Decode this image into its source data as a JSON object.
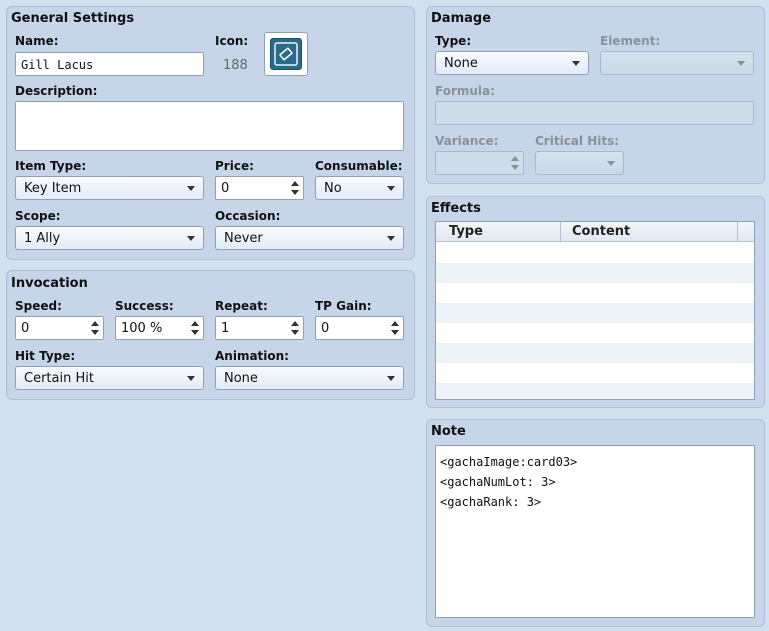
{
  "general": {
    "title": "General Settings",
    "name_label": "Name:",
    "name_value": "Gill Lacus",
    "icon_label": "Icon:",
    "icon_index": "188",
    "description_label": "Description:",
    "description_value": "",
    "item_type_label": "Item Type:",
    "item_type_value": "Key Item",
    "price_label": "Price:",
    "price_value": "0",
    "consumable_label": "Consumable:",
    "consumable_value": "No",
    "scope_label": "Scope:",
    "scope_value": "1 Ally",
    "occasion_label": "Occasion:",
    "occasion_value": "Never"
  },
  "invocation": {
    "title": "Invocation",
    "speed_label": "Speed:",
    "speed_value": "0",
    "success_label": "Success:",
    "success_value": "100 %",
    "repeat_label": "Repeat:",
    "repeat_value": "1",
    "tp_gain_label": "TP Gain:",
    "tp_gain_value": "0",
    "hit_type_label": "Hit Type:",
    "hit_type_value": "Certain Hit",
    "animation_label": "Animation:",
    "animation_value": "None"
  },
  "damage": {
    "title": "Damage",
    "type_label": "Type:",
    "type_value": "None",
    "element_label": "Element:",
    "element_value": "",
    "formula_label": "Formula:",
    "formula_value": "",
    "variance_label": "Variance:",
    "variance_value": "",
    "critical_label": "Critical Hits:",
    "critical_value": ""
  },
  "effects": {
    "title": "Effects",
    "columns": [
      "Type",
      "Content"
    ]
  },
  "note": {
    "title": "Note",
    "lines": [
      "<gachaImage:card03>",
      "<gachaNumLot: 3>",
      "<gachaRank: 3>"
    ]
  }
}
